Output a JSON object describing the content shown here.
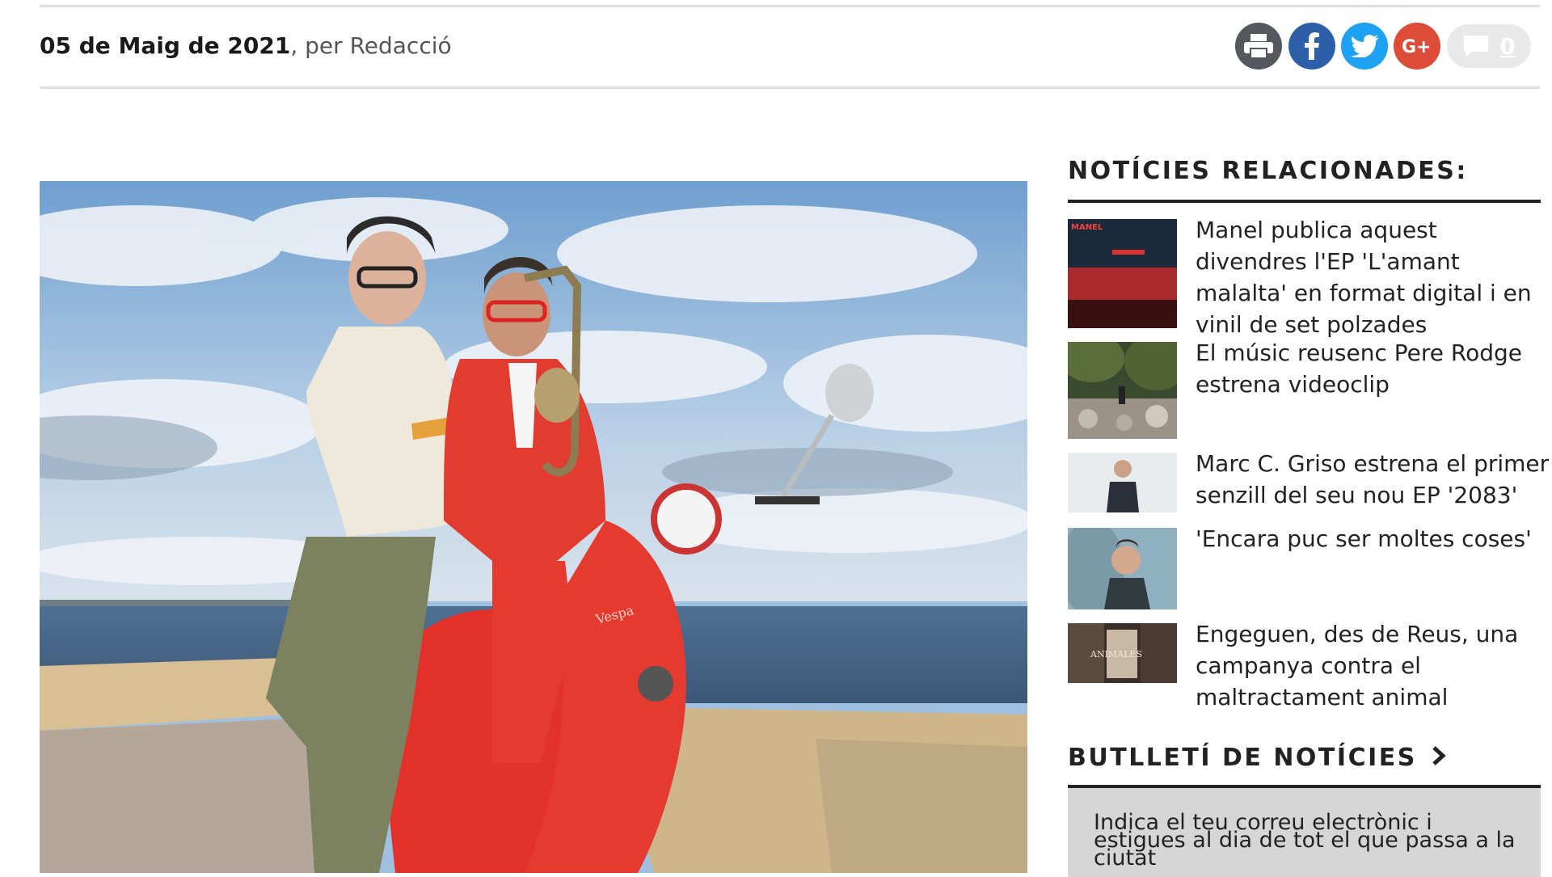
{
  "article": {
    "date": "05 de Maig de 2021",
    "byline": ", per Redacció"
  },
  "share": {
    "icons": [
      "print-icon",
      "facebook-icon",
      "twitter-icon",
      "google-plus-icon",
      "comment-icon"
    ],
    "comment_count": "0",
    "colors": {
      "print": "#55595e",
      "facebook": "#2d5fa8",
      "twitter": "#1da1f2",
      "google_plus": "#dd4b39",
      "comments": "#e9e9e9"
    }
  },
  "sidebar": {
    "related_heading": "NOTÍCIES RELACIONADES:",
    "related": [
      {
        "title": "Manel publica aquest divendres l'EP 'L'amant malalta' en format digital i en vinil de set polzades",
        "thumb_text": "MANEL"
      },
      {
        "title": "El músic reusenc Pere Rodge estrena videoclip"
      },
      {
        "title": "Marc C. Griso estrena el primer senzill del seu nou EP '2083'"
      },
      {
        "title": "'Encara puc ser moltes coses'"
      },
      {
        "title": "Engeguen, des de Reus, una campanya contra el maltractament animal",
        "thumb_text": "ANIMALES"
      }
    ],
    "newsletter_heading": "BUTLLETÍ DE NOTÍCIES",
    "newsletter_text": "Indica el teu correu electrònic i estigues al dia de tot el que passa a la ciutat"
  }
}
